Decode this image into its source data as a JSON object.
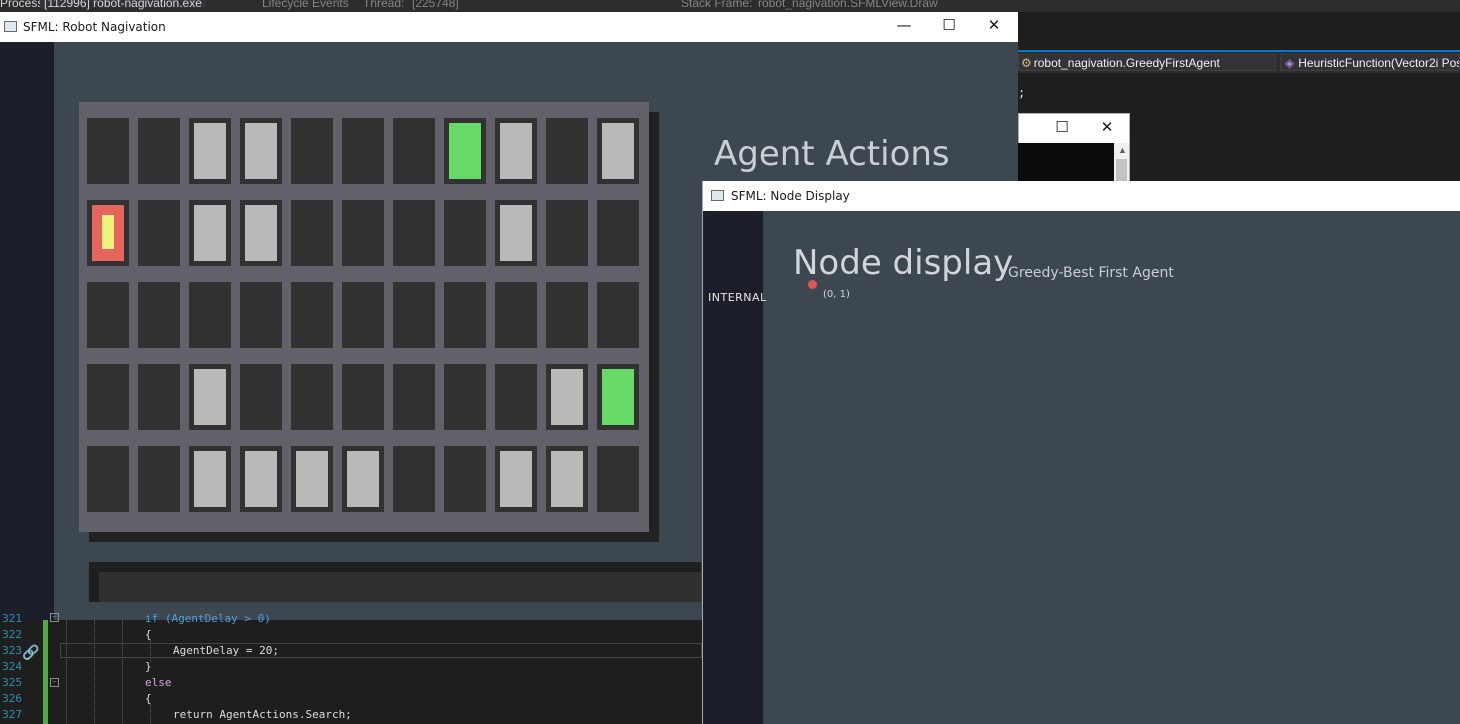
{
  "vs": {
    "process_label": "Process:",
    "process_value": "[112996] robot-nagivation.exe",
    "lifecycle": "Lifecycle Events",
    "thread_label": "Thread:",
    "thread_value": "[225748]",
    "stackframe_label": "Stack Frame:",
    "stackframe_value": "robot_nagivation.SFMLView.Draw",
    "nav_class": "robot_nagivation.GreedyFirstAgent",
    "nav_member": "HeuristicFunction(Vector2i Pos",
    "code_snippet_char": ";"
  },
  "robot_window": {
    "title": "SFML: Robot Nagivation",
    "actions_heading": "Agent Actions",
    "grid": {
      "rows": [
        [
          "empty",
          "empty",
          "wall",
          "wall",
          "empty",
          "empty",
          "empty",
          "goal",
          "wall",
          "empty",
          "wall"
        ],
        [
          "agent",
          "empty",
          "wall",
          "wall",
          "empty",
          "empty",
          "empty",
          "empty",
          "wall",
          "empty",
          "empty"
        ],
        [
          "empty",
          "empty",
          "empty",
          "empty",
          "empty",
          "empty",
          "empty",
          "empty",
          "empty",
          "empty",
          "empty"
        ],
        [
          "empty",
          "empty",
          "wall",
          "empty",
          "empty",
          "empty",
          "empty",
          "empty",
          "empty",
          "wall",
          "goal"
        ],
        [
          "empty",
          "empty",
          "wall",
          "wall",
          "wall",
          "wall",
          "empty",
          "empty",
          "wall",
          "wall",
          "empty"
        ]
      ]
    }
  },
  "node_window": {
    "title": "SFML: Node Display",
    "sidebar_label": "INTERNAL",
    "heading": "Node display",
    "subtitle": "Greedy-Best First Agent",
    "node_coord": "(0, 1)"
  },
  "code": {
    "lines": [
      {
        "num": "321",
        "text": "if (AgentDelay > 0)"
      },
      {
        "num": "322",
        "text": "{"
      },
      {
        "num": "323",
        "text": "AgentDelay = 20;"
      },
      {
        "num": "324",
        "text": "}"
      },
      {
        "num": "325",
        "text": "else"
      },
      {
        "num": "326",
        "text": "{"
      },
      {
        "num": "327",
        "text": "return AgentActions.Search;"
      }
    ]
  },
  "window_controls": {
    "minimize": "—",
    "maximize": "☐",
    "close": "✕"
  },
  "colors": {
    "wall": "#b9b9b9",
    "goal": "#66d967",
    "agent": "#e4655b",
    "agent_marker": "#eef27a",
    "window_bg": "#3d4750"
  }
}
